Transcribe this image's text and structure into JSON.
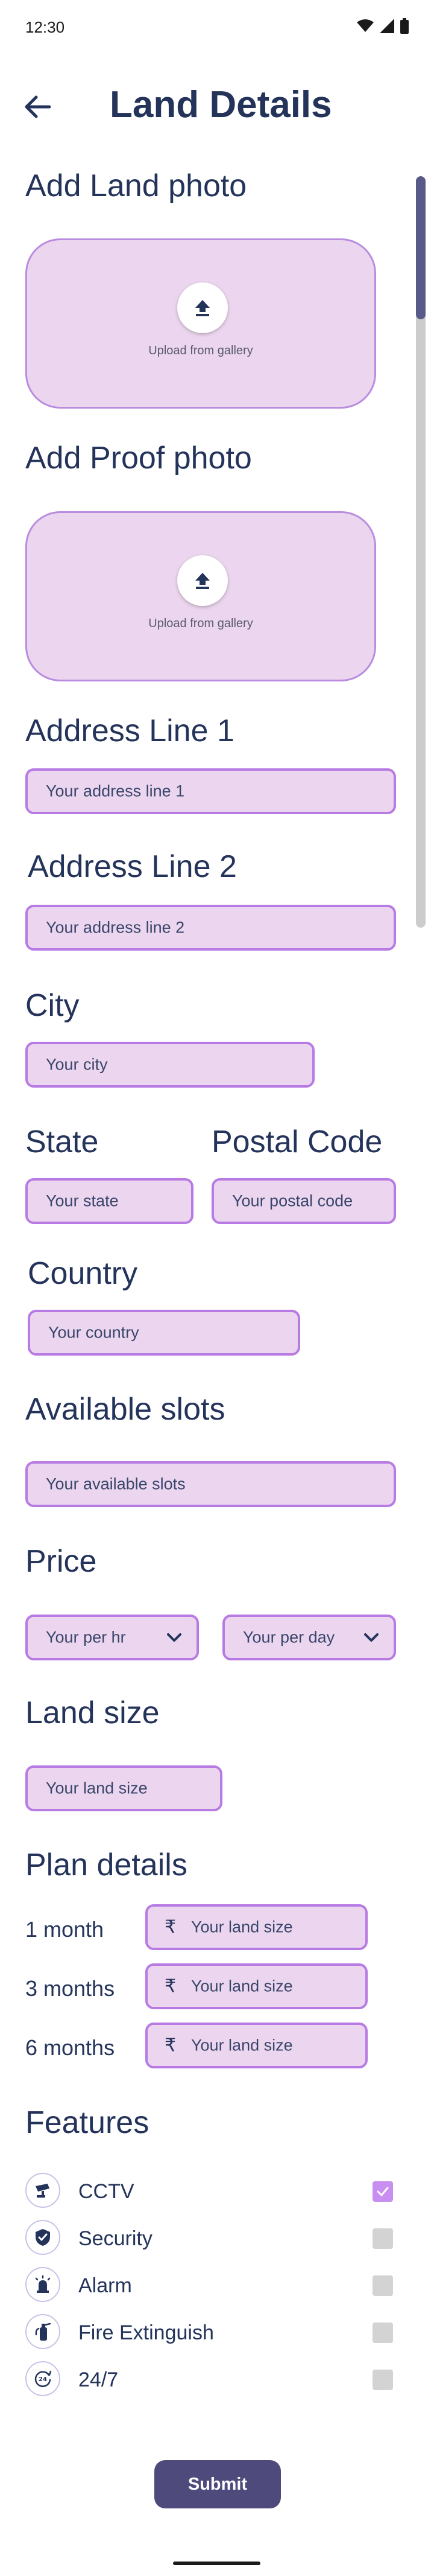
{
  "status_bar": {
    "time": "12:30"
  },
  "header": {
    "title": "Land Details"
  },
  "land_photo": {
    "label": "Add Land photo",
    "upload_text": "Upload from gallery"
  },
  "proof_photo": {
    "label": "Add Proof photo",
    "upload_text": "Upload from gallery"
  },
  "address1": {
    "label": "Address Line 1",
    "placeholder": "Your address line 1"
  },
  "address2": {
    "label": "Address Line 2",
    "placeholder": "Your address line 2"
  },
  "city": {
    "label": "City",
    "placeholder": "Your city"
  },
  "state": {
    "label": "State",
    "placeholder": "Your state"
  },
  "postal_code": {
    "label": "Postal Code",
    "placeholder": "Your postal code"
  },
  "country": {
    "label": "Country",
    "placeholder": "Your country"
  },
  "slots": {
    "label": "Available slots",
    "placeholder": "Your available slots"
  },
  "price": {
    "label": "Price",
    "per_hr_placeholder": "Your per hr",
    "per_day_placeholder": "Your per day"
  },
  "land_size": {
    "label": "Land size",
    "placeholder": "Your land size"
  },
  "plan_details": {
    "label": "Plan details",
    "currency_symbol": "₹",
    "plans": [
      {
        "duration": "1 month",
        "placeholder": "Your land size"
      },
      {
        "duration": "3 months",
        "placeholder": "Your land size"
      },
      {
        "duration": "6 months",
        "placeholder": "Your land size"
      }
    ]
  },
  "features": {
    "label": "Features",
    "items": [
      {
        "name": "CCTV",
        "icon": "cctv-icon",
        "checked": true
      },
      {
        "name": "Security",
        "icon": "shield-icon",
        "checked": false
      },
      {
        "name": "Alarm",
        "icon": "alarm-icon",
        "checked": false
      },
      {
        "name": "Fire Extinguish",
        "icon": "fire-extinguisher-icon",
        "checked": false
      },
      {
        "name": "24/7",
        "icon": "clock-24-icon",
        "checked": false
      }
    ]
  },
  "submit_label": "Submit",
  "colors": {
    "title": "#24335a",
    "field_fill": "#ecd6ef",
    "field_border": "#b77be3",
    "checkbox_checked": "#c88ff0",
    "checkbox_unchecked": "#d3d3d3",
    "submit": "#4e4a7c",
    "scroll_thumb": "#585a87"
  }
}
